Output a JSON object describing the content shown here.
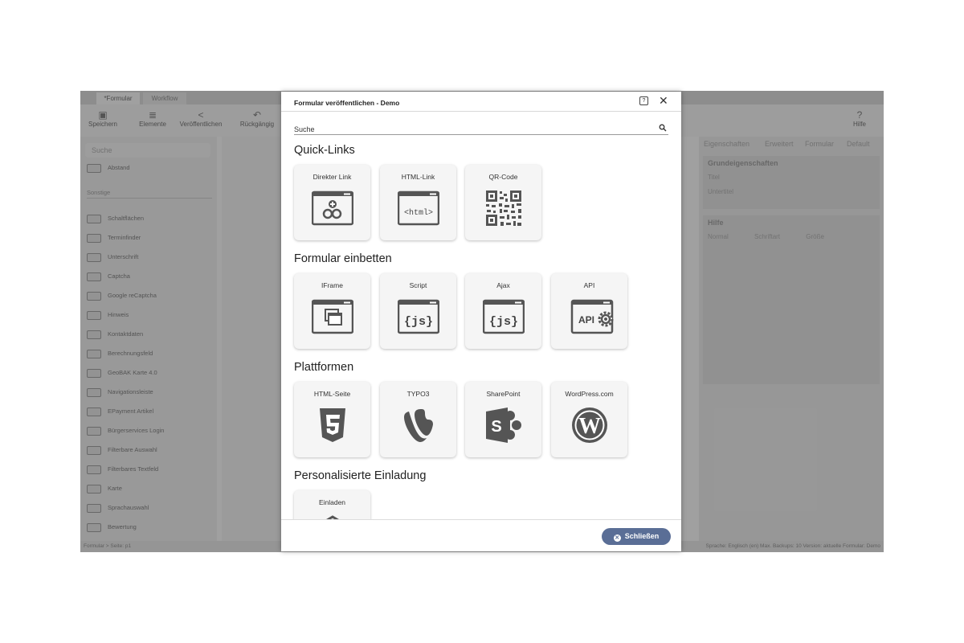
{
  "app": {
    "tabs": [
      "*Formular",
      "Workflow"
    ],
    "toolbar": {
      "save_label": "Speichern",
      "elements_label": "Elemente",
      "publish_label": "Veröffentlichen",
      "undo_label": "Rückgängig",
      "help_label": "Hilfe"
    },
    "left_panel": {
      "search_placeholder": "Suche",
      "first_item": "Abstand",
      "section_other": "Sonstige",
      "items": [
        "Schaltflächen",
        "Terminfinder",
        "Unterschrift",
        "Captcha",
        "Google reCaptcha",
        "Hinweis",
        "Kontaktdaten",
        "Berechnungsfeld",
        "GeoBAK Karte 4.0",
        "Navigationsleiste",
        "EPayment Artikel",
        "Bürgerservices Login",
        "Filterbare Auswahl",
        "Filterbares Textfeld",
        "Karte",
        "Sprachauswahl",
        "Bewertung"
      ]
    },
    "right_panel": {
      "tabs": [
        "Eigenschaften",
        "Erweitert",
        "Formular",
        "Default"
      ],
      "basic_title": "Grundeigenschaften",
      "title_label": "Titel",
      "subtitle_label": "Untertitel",
      "help_title": "Hilfe",
      "editor_format": "Normal",
      "editor_font": "Schriftart",
      "editor_size": "Größe"
    },
    "status": {
      "breadcrumb": "Formular > Seite: p1",
      "info": "Sprache: Englisch (en)  Max. Backups: 10  Version: aktuelle  Formular: Demo"
    }
  },
  "modal": {
    "title": "Formular veröffentlichen - Demo",
    "search_placeholder": "Suche",
    "sections": [
      {
        "title": "Quick-Links",
        "cards": [
          {
            "label": "Direkter Link",
            "icon": "window-link-icon"
          },
          {
            "label": "HTML-Link",
            "icon": "window-html-icon"
          },
          {
            "label": "QR-Code",
            "icon": "qr-code-icon"
          }
        ]
      },
      {
        "title": "Formular einbetten",
        "cards": [
          {
            "label": "IFrame",
            "icon": "window-iframe-icon"
          },
          {
            "label": "Script",
            "icon": "window-js-icon"
          },
          {
            "label": "Ajax",
            "icon": "window-js-icon"
          },
          {
            "label": "API",
            "icon": "window-api-icon"
          }
        ]
      },
      {
        "title": "Plattformen",
        "cards": [
          {
            "label": "HTML-Seite",
            "icon": "html5-icon"
          },
          {
            "label": "TYPO3",
            "icon": "typo3-icon"
          },
          {
            "label": "SharePoint",
            "icon": "sharepoint-icon"
          },
          {
            "label": "WordPress.com",
            "icon": "wordpress-icon"
          }
        ]
      },
      {
        "title": "Personalisierte Einladung",
        "cards": [
          {
            "label": "Einladen",
            "icon": "invite-icon"
          }
        ]
      }
    ],
    "html_snippet": "<html>",
    "js_snippet": "{js}",
    "api_snippet": "API",
    "close_button": "Schließen"
  }
}
